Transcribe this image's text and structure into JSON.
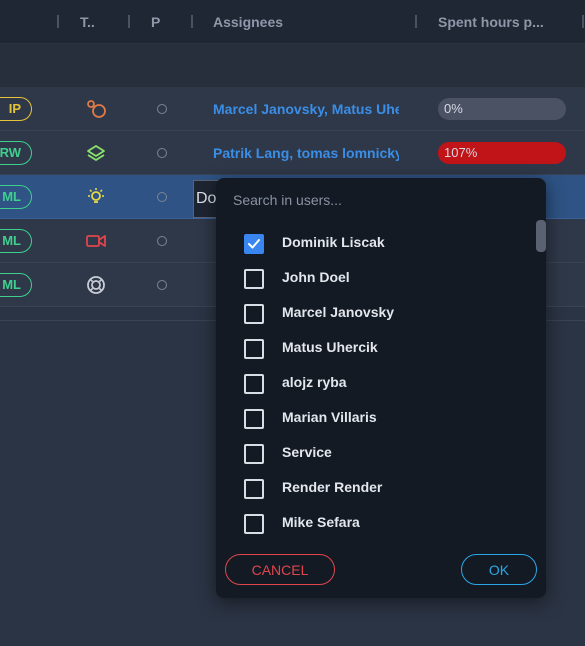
{
  "table": {
    "columns": [
      {
        "label": "T.."
      },
      {
        "label": "P"
      },
      {
        "label": "Assignees"
      },
      {
        "label": "Spent hours p..."
      }
    ],
    "rows": [
      {
        "badge": "IP",
        "badge_color": "#e6c43a",
        "type_icon": "git-merge-icon",
        "type_color": "#e07a45",
        "assignees": "Marcel Janovsky, Matus Uhercik",
        "spent": "0%",
        "over": false
      },
      {
        "badge": "RW",
        "badge_color": "#3fcf8e",
        "type_icon": "layers-icon",
        "type_color": "#8be36a",
        "assignees": "Patrik Lang, tomas lomnicky",
        "spent": "107%",
        "over": true
      },
      {
        "badge": "ML",
        "badge_color": "#3fcf8e",
        "type_icon": "bulb-icon",
        "type_color": "#e6d84a",
        "assignees": "Do",
        "spent": "",
        "over": false,
        "selected": true
      },
      {
        "badge": "ML",
        "badge_color": "#3fcf8e",
        "type_icon": "video-camera-icon",
        "type_color": "#e0454c",
        "assignees": "",
        "spent": "",
        "over": false
      },
      {
        "badge": "ML",
        "badge_color": "#3fcf8e",
        "type_icon": "settings-ring-icon",
        "type_color": "#c8cdd6",
        "assignees": "",
        "spent": "",
        "over": false
      }
    ]
  },
  "editor": {
    "value": "Do"
  },
  "dropdown": {
    "search_placeholder": "Search in users...",
    "items": [
      {
        "label": "Dominik Liscak",
        "checked": true
      },
      {
        "label": "John Doel",
        "checked": false
      },
      {
        "label": "Marcel Janovsky",
        "checked": false
      },
      {
        "label": "Matus Uhercik",
        "checked": false
      },
      {
        "label": "alojz ryba",
        "checked": false
      },
      {
        "label": "Marian Villaris",
        "checked": false
      },
      {
        "label": "Service",
        "checked": false
      },
      {
        "label": "Render Render",
        "checked": false
      },
      {
        "label": "Mike Sefara",
        "checked": false
      }
    ],
    "cancel_label": "CANCEL",
    "ok_label": "OK"
  }
}
